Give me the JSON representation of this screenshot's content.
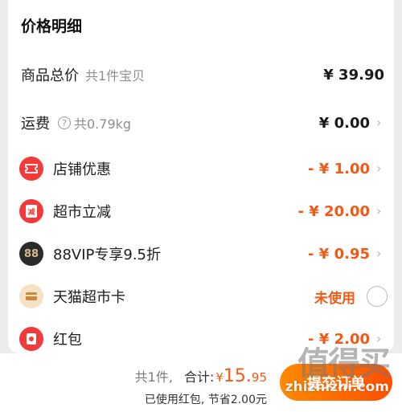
{
  "section_title": "价格明细",
  "rows": {
    "total": {
      "label": "商品总价",
      "sub": "共1件宝贝",
      "value": "¥ 39.90"
    },
    "shipping": {
      "label": "运费",
      "sub": "共0.79kg",
      "value": "¥ 0.00",
      "help_icon": "question-circle-icon"
    },
    "store_discount": {
      "label": "店铺优惠",
      "value": "- ¥ 1.00",
      "icon": "ticket-icon"
    },
    "market_reduce": {
      "label": "超市立减",
      "value": "- ¥ 20.00",
      "icon": "reduce-badge-icon",
      "badge_text": "减"
    },
    "vip": {
      "label": "88VIP专享9.5折",
      "value": "- ¥ 0.95",
      "icon": "vip88-icon",
      "badge_text": "88"
    },
    "tmall_card": {
      "label": "天猫超市卡",
      "value": "未使用",
      "icon": "card-icon"
    },
    "red_packet": {
      "label": "红包",
      "value": "- ¥ 2.00",
      "icon": "red-packet-icon"
    }
  },
  "footer": {
    "count": "共1件,",
    "total_label": "合计:",
    "yen": "¥",
    "total_int": "15.",
    "total_dec": "95",
    "saved": "已使用红包, 节省2.00元",
    "submit": "提交订单"
  },
  "watermark": {
    "top": "值得买",
    "url": "zhizhizhi.com"
  },
  "colors": {
    "accent": "#f05a14",
    "icon_red": "#f23a3a",
    "vip_dark": "#2b2b2b"
  }
}
